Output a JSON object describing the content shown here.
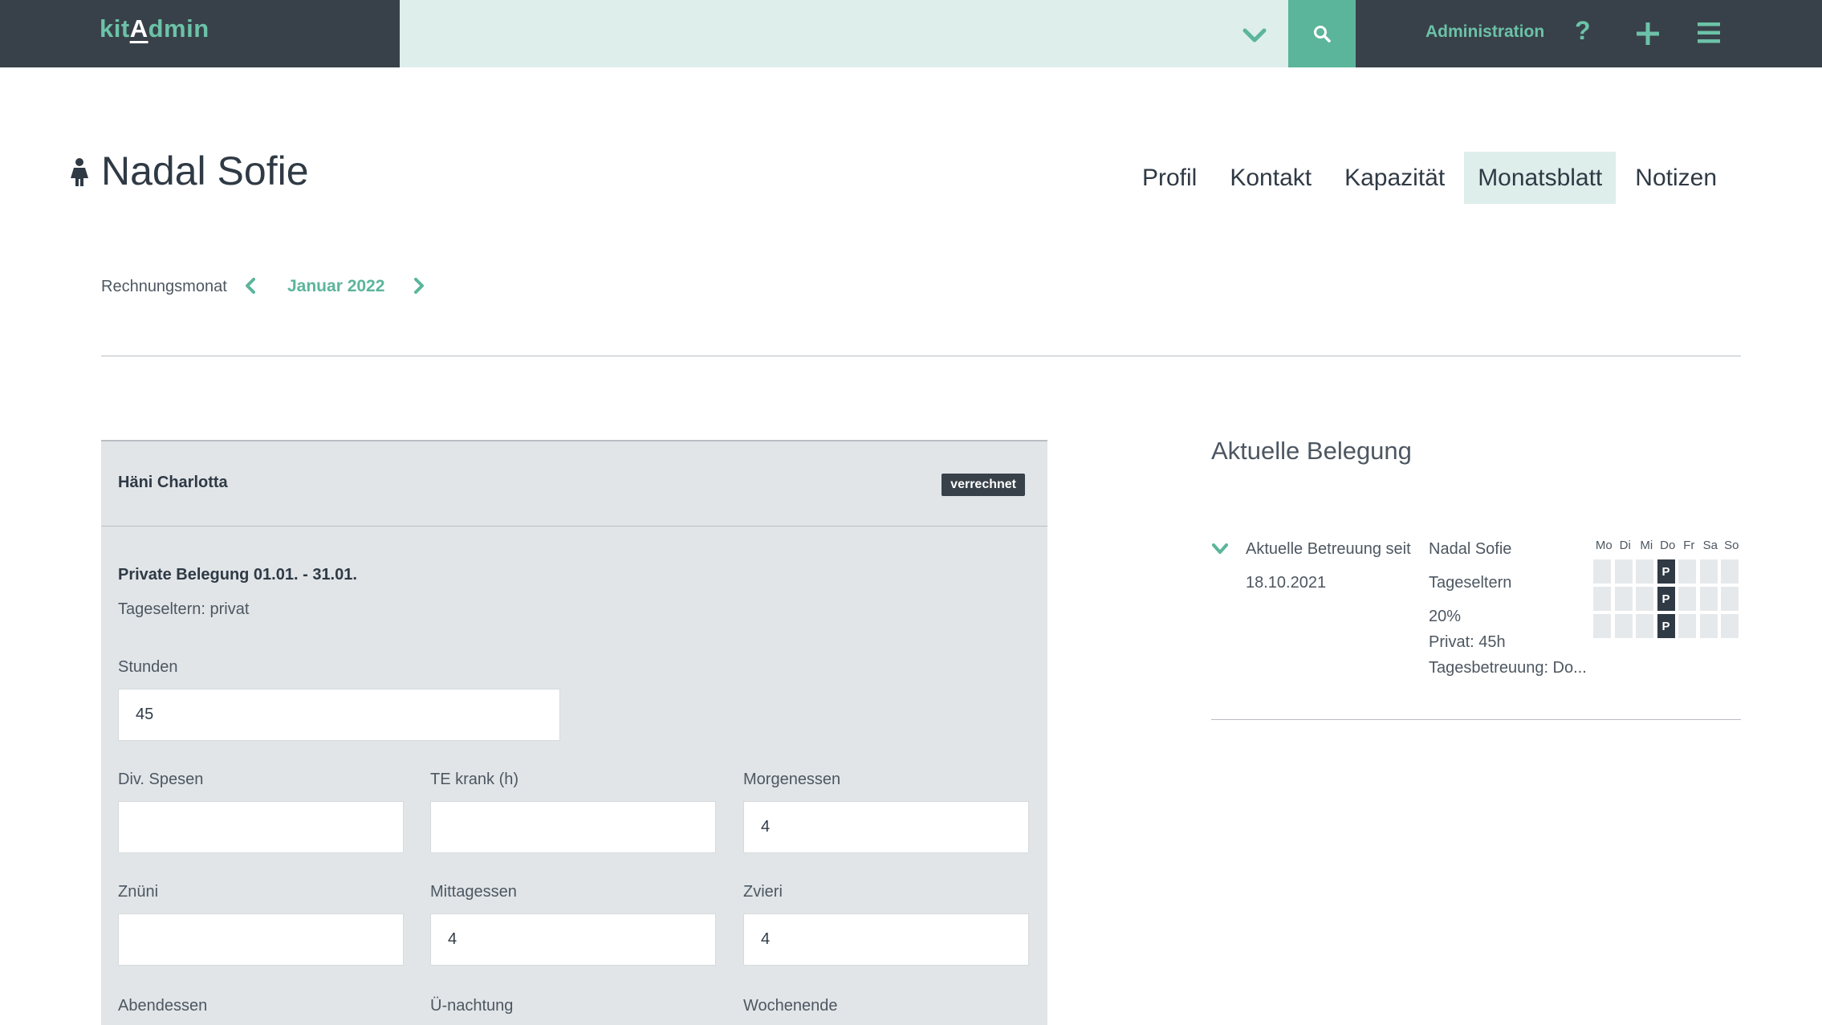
{
  "topbar": {
    "logo_prefix": "kit",
    "logo_accent": "A",
    "logo_suffix": "dmin",
    "search_value": "",
    "admin_label": "Administration",
    "help_label": "?",
    "icons": [
      "chevron-down-icon",
      "search-icon",
      "help-icon",
      "plus-icon",
      "menu-icon"
    ]
  },
  "header": {
    "title": "Nadal Sofie",
    "tabs": [
      {
        "label": "Profil",
        "active": false
      },
      {
        "label": "Kontakt",
        "active": false
      },
      {
        "label": "Kapazität",
        "active": false
      },
      {
        "label": "Monatsblatt",
        "active": true
      },
      {
        "label": "Notizen",
        "active": false
      }
    ]
  },
  "month": {
    "label": "Rechnungsmonat",
    "value": "Januar 2022"
  },
  "panel": {
    "name": "Häni Charlotta",
    "badge": "verrechnet",
    "booking_title": "Private Belegung 01.01. - 31.01.",
    "booking_sub": "Tageseltern: privat",
    "fields": {
      "stunden": {
        "label": "Stunden",
        "value": "45"
      },
      "spesen": {
        "label": "Div. Spesen",
        "value": ""
      },
      "te_krank": {
        "label": "TE krank (h)",
        "value": ""
      },
      "morgenessen": {
        "label": "Morgenessen",
        "value": "4"
      },
      "zntini": {
        "label": "Znüni",
        "value": ""
      },
      "mittagessen": {
        "label": "Mittagessen",
        "value": "4"
      },
      "zvieri": {
        "label": "Zvieri",
        "value": "4"
      },
      "abendessen": {
        "label": "Abendessen",
        "value": ""
      },
      "uenachtung": {
        "label": "Ü-nachtung",
        "value": ""
      },
      "wochenende": {
        "label": "Wochenende",
        "value": ""
      }
    }
  },
  "occupancy": {
    "title": "Aktuelle Belegung",
    "since_label": "Aktuelle Betreuung seit",
    "since_date": "18.10.2021",
    "lines": [
      "Nadal Sofie",
      "Tageseltern",
      "20%",
      "Privat: 45h",
      "Tagesbetreuung: Do..."
    ],
    "days": [
      "Mo",
      "Di",
      "Mi",
      "Do",
      "Fr",
      "Sa",
      "So"
    ],
    "grid": [
      [
        "",
        "",
        "",
        "P",
        "",
        "",
        ""
      ],
      [
        "",
        "",
        "",
        "P",
        "",
        "",
        ""
      ],
      [
        "",
        "",
        "",
        "P",
        "",
        "",
        ""
      ]
    ]
  },
  "colors": {
    "topbar": "#384149",
    "accent": "#5bb59a",
    "search_bg": "#deeeeb",
    "panel_bg": "#e1e5e8"
  }
}
